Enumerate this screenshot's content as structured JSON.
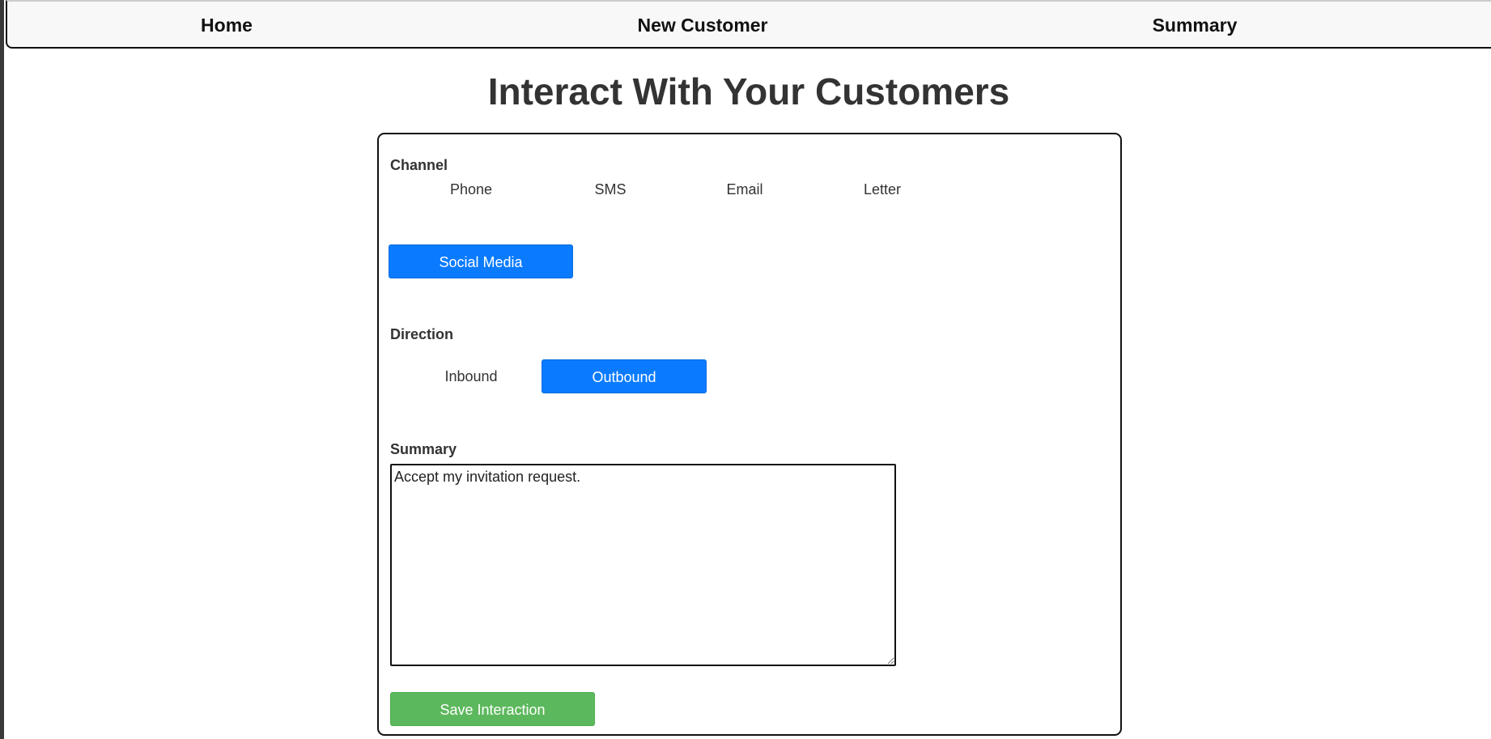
{
  "nav": {
    "home": "Home",
    "new_customer": "New Customer",
    "summary": "Summary"
  },
  "page": {
    "title": "Interact With Your Customers"
  },
  "form": {
    "channel": {
      "label": "Channel",
      "options": [
        "Phone",
        "SMS",
        "Email",
        "Letter",
        "Social Media"
      ],
      "selected": "Social Media"
    },
    "direction": {
      "label": "Direction",
      "options": [
        "Inbound",
        "Outbound"
      ],
      "selected": "Outbound"
    },
    "summary": {
      "label": "Summary",
      "value": "Accept my invitation request."
    },
    "save_label": "Save Interaction"
  },
  "colors": {
    "active_button": "#0a7bff",
    "save_button": "#5cb85c",
    "nav_background": "#f8f8f8"
  }
}
